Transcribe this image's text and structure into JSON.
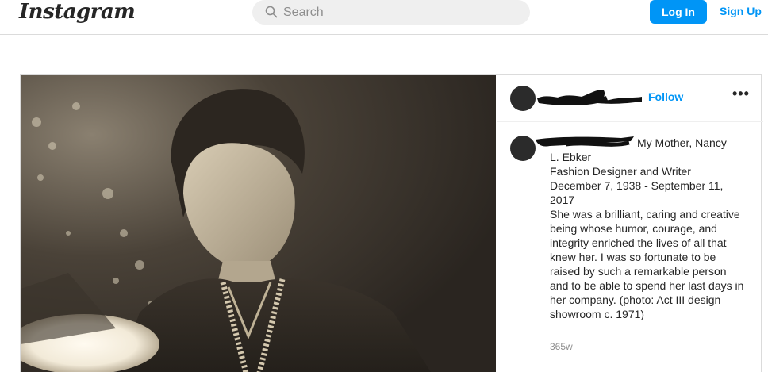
{
  "nav": {
    "logo": "Instagram",
    "search_placeholder": "Search",
    "login_label": "Log In",
    "signup_label": "Sign Up"
  },
  "post": {
    "header": {
      "follow_label": "Follow",
      "more_label": "•••"
    },
    "caption_lines": [
      "My Mother, Nancy",
      "L. Ebker",
      "Fashion Designer and Writer",
      "December 7, 1938 - September 11, 2017",
      "She was a brilliant, caring and creative being whose humor, courage, and integrity enriched the lives of all that knew her. I was so fortunate to be raised by such a remarkable person and to be able to spend her last days in her company. (photo: Act III design showroom c. 1971)"
    ],
    "time_ago": "365w"
  },
  "colors": {
    "accent": "#0095f6",
    "text": "#262626",
    "muted": "#8e8e8e",
    "border": "#dbdbdb"
  },
  "icons": {
    "search": "search-icon",
    "more": "more-options-icon"
  }
}
